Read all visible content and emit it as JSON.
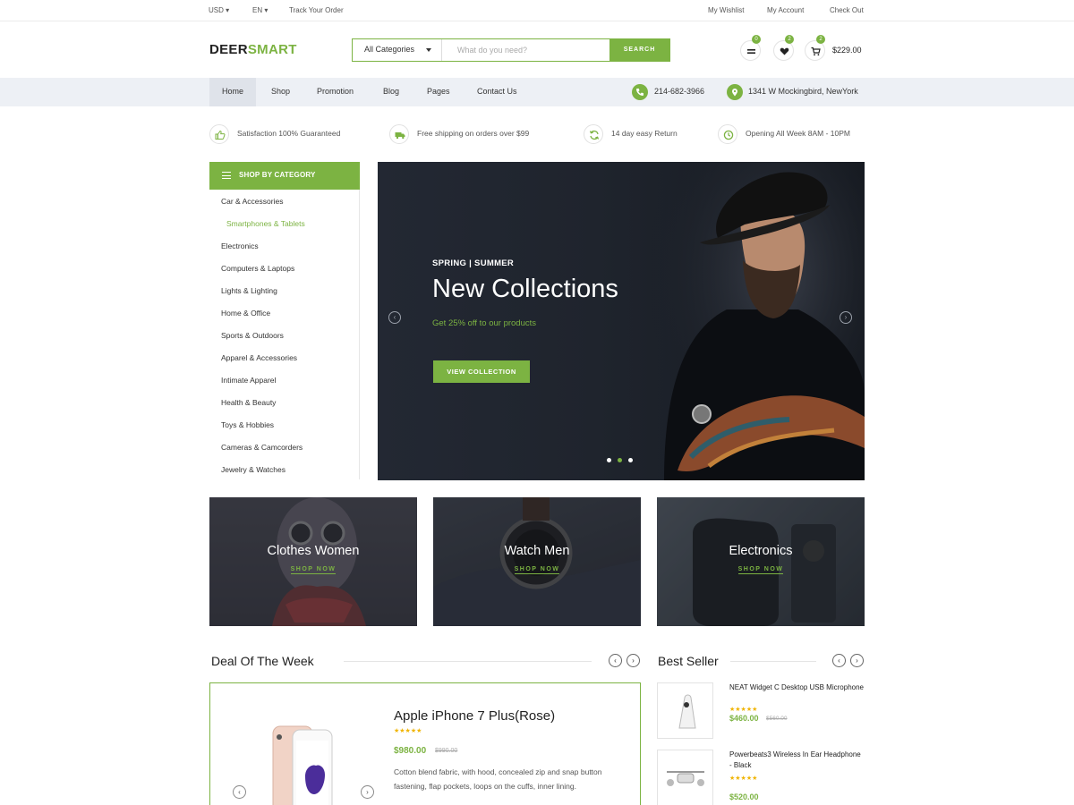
{
  "topbar": {
    "currency": "USD",
    "language": "EN",
    "track_order": "Track Your Order",
    "wishlist": "My Wishlist",
    "account": "My Account",
    "checkout": "Check Out"
  },
  "brand": {
    "part1": "DEER",
    "part2": "SMART",
    "accent_color": "#7cb342"
  },
  "search": {
    "category": "All Categories",
    "placeholder": "What do you need?",
    "button": "SEARCH"
  },
  "header_icons": [
    {
      "icon": "compare-icon",
      "count": "0"
    },
    {
      "icon": "heart-icon",
      "count": "2"
    },
    {
      "icon": "cart-icon",
      "count": "2"
    }
  ],
  "cart_total": "$229.00",
  "nav": {
    "items": [
      "Home",
      "Shop",
      "Promotion",
      "Blog",
      "Pages",
      "Contact Us"
    ],
    "active": "Home",
    "phone": "214-682-3966",
    "address": "1341 W Mockingbird, NewYork"
  },
  "features": [
    {
      "icon": "thumbs-up-icon",
      "label": "Satisfaction 100% Guaranteed"
    },
    {
      "icon": "truck-icon",
      "label": "Free shipping on orders over $99"
    },
    {
      "icon": "return-icon",
      "label": "14 day easy Return"
    },
    {
      "icon": "clock-icon",
      "label": "Opening All Week 8AM - 10PM"
    }
  ],
  "categories": {
    "title": "SHOP BY CATEGORY",
    "items": [
      "Car & Accessories",
      "Smartphones & Tablets",
      "Electronics",
      "Computers & Laptops",
      "Lights & Lighting",
      "Home & Office",
      "Sports & Outdoors",
      "Apparel & Accessories",
      "Intimate Apparel",
      "Health & Beauty",
      "Toys & Hobbies",
      "Cameras & Camcorders",
      "Jewelry & Watches"
    ],
    "highlighted": "Smartphones & Tablets"
  },
  "hero": {
    "kicker": "SPRING | SUMMER",
    "title": "New Collections",
    "subtitle": "Get 25% off to our products",
    "cta": "VIEW COLLECTION",
    "slides": 3,
    "active_slide": 2
  },
  "banners": [
    {
      "title": "Clothes Women",
      "cta": "SHOP NOW"
    },
    {
      "title": "Watch Men",
      "cta": "SHOP NOW"
    },
    {
      "title": "Electronics",
      "cta": "SHOP NOW"
    }
  ],
  "deal": {
    "section_title": "Deal Of The Week",
    "product_name": "Apple iPhone 7 Plus(Rose)",
    "rating": 5,
    "price": "$980.00",
    "old_price": "$990.00",
    "description": "Cotton blend fabric, with hood, concealed zip and snap button fastening, flap pockets, loops on the cuffs, inner lining."
  },
  "best_seller": {
    "section_title": "Best Seller",
    "items": [
      {
        "name": "NEAT Widget C Desktop USB Microphone",
        "rating": 5,
        "price": "$460.00",
        "old_price": "$560.00"
      },
      {
        "name": "Powerbeats3 Wireless In Ear Headphone - Black",
        "rating": 5,
        "price": "$520.00",
        "old_price": ""
      }
    ]
  }
}
